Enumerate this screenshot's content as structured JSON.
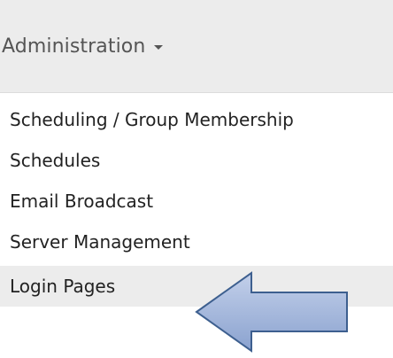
{
  "navbar": {
    "dropdown_label": "Administration",
    "caret_icon": "caret-down-icon"
  },
  "menu": {
    "items": [
      {
        "label": "Scheduling / Group Membership"
      },
      {
        "label": "Schedules"
      },
      {
        "label": "Email Broadcast"
      },
      {
        "label": "Server Management"
      },
      {
        "label": "Login Pages",
        "highlighted": true
      }
    ]
  },
  "annotation": {
    "pointer_icon": "left-arrow-callout-icon",
    "fill_color": "#9fb3d9",
    "stroke_color": "#3d5f8f"
  }
}
